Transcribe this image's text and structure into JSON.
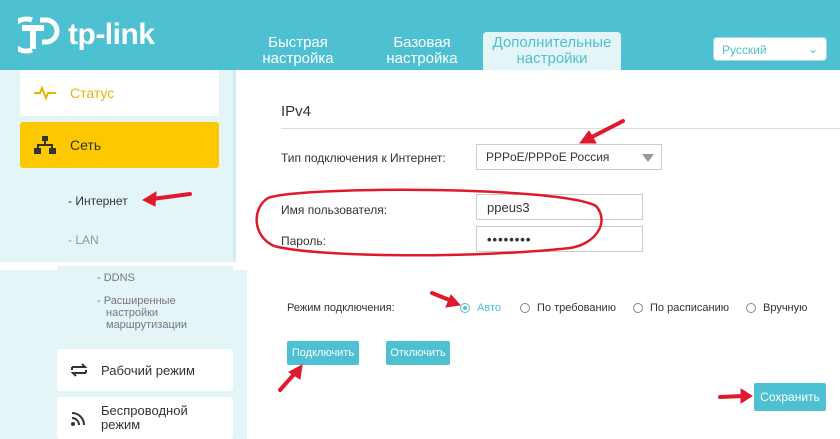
{
  "header": {
    "brand": "tp-link",
    "tabs": [
      {
        "line1": "Быстрая",
        "line2": "настройка"
      },
      {
        "line1": "Базовая",
        "line2": "настройка"
      },
      {
        "line1": "Дополнительные",
        "line2": "настройки"
      }
    ],
    "language": "Русский"
  },
  "sidebar": {
    "status": "Статус",
    "network": "Сеть",
    "internet": "- Интернет",
    "lan": "- LAN",
    "ddns": "- DDNS",
    "advanced_routing_1": "- Расширенные",
    "advanced_routing_2": "настройки",
    "advanced_routing_3": "маршрутизации",
    "operation_mode": "Рабочий режим",
    "wireless_1": "Беспроводной",
    "wireless_2": "режим"
  },
  "main": {
    "section_title": "IPv4",
    "connection_type_label": "Тип подключения к Интернет:",
    "connection_type_value": "PPPoE/PPPoE Россия",
    "username_label": "Имя пользователя:",
    "username_value": "ppeus3",
    "password_label": "Пароль:",
    "password_value": "••••••••",
    "mode_label": "Режим подключения:",
    "modes": [
      "Авто",
      "По требованию",
      "По расписанию",
      "Вручную"
    ],
    "selected_mode": "Авто",
    "connect_button": "Подключить",
    "disconnect_button": "Отключить",
    "save_button": "Сохранить"
  },
  "colors": {
    "brand": "#4dc1d2",
    "highlight": "#fcc900",
    "annotation": "#e0192c"
  }
}
